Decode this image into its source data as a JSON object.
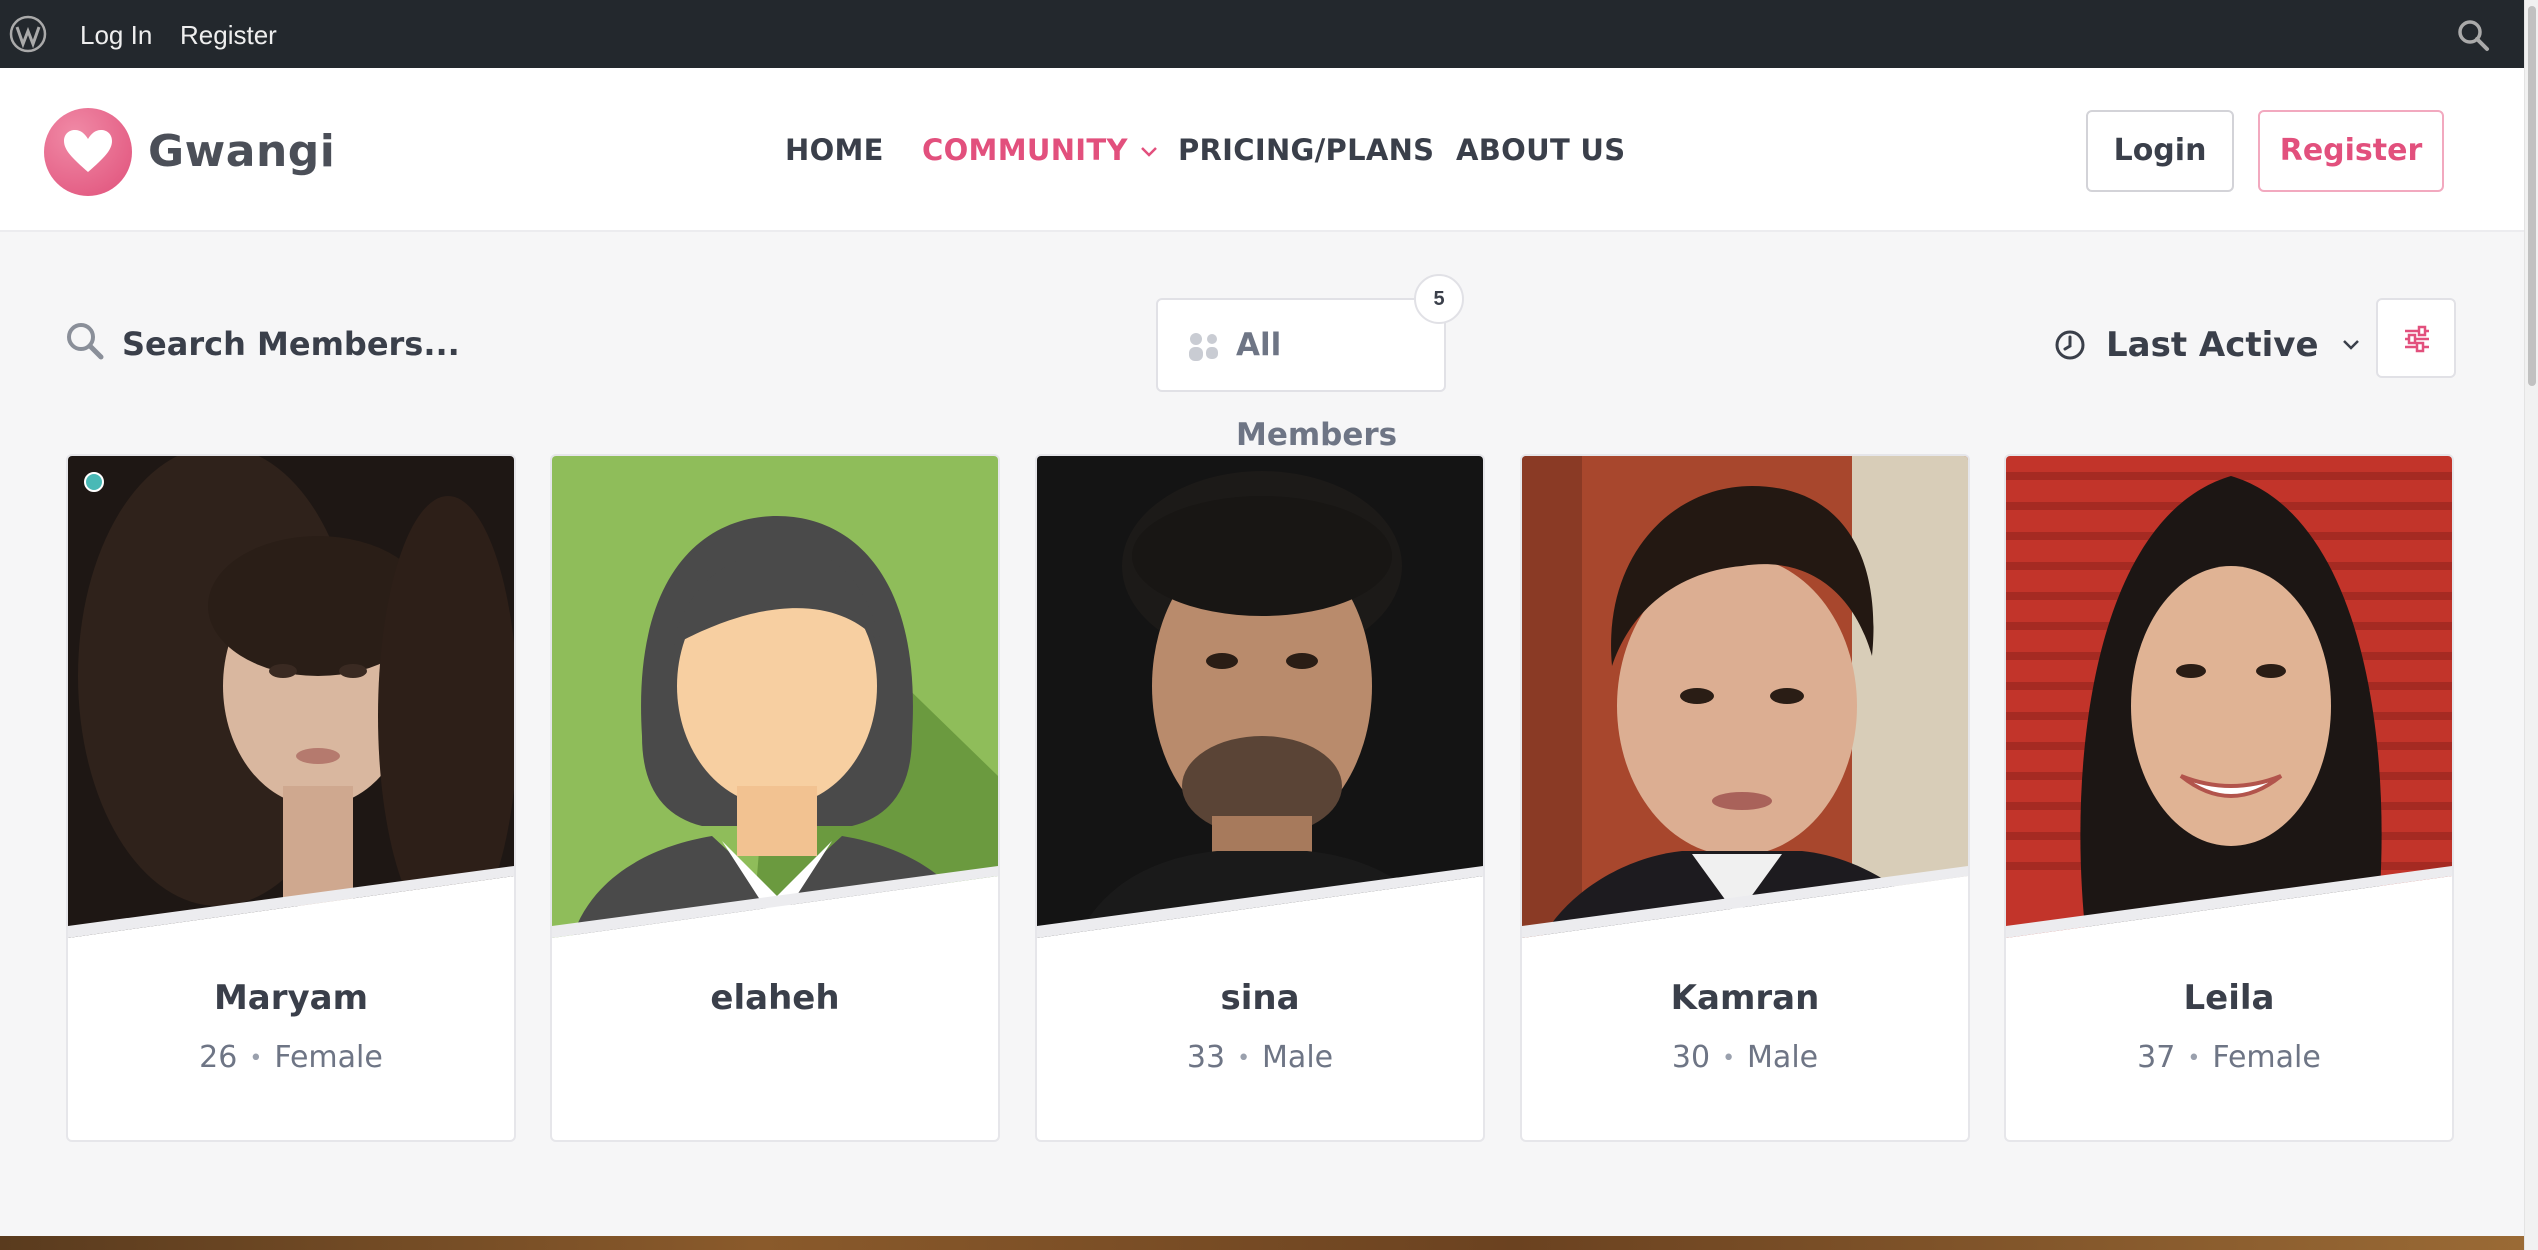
{
  "admin_bar": {
    "login": "Log In",
    "register": "Register"
  },
  "header": {
    "logo_text": "Gwangi",
    "nav": {
      "home": "HOME",
      "community": "COMMUNITY",
      "pricing": "PRICING/PLANS",
      "about": "ABOUT US"
    },
    "login_button": "Login",
    "register_button": "Register"
  },
  "toolbar": {
    "search_placeholder": "Search Members...",
    "filter_label": "All Members",
    "member_count": "5",
    "sort_label": "Last Active"
  },
  "colors": {
    "accent": "#e2507d",
    "online": "#49b9b6",
    "admin_bar": "#23282d"
  },
  "members": [
    {
      "name": "Maryam",
      "age": "26",
      "gender": "Female",
      "online": true
    },
    {
      "name": "elaheh",
      "age": "",
      "gender": "",
      "online": false
    },
    {
      "name": "sina",
      "age": "33",
      "gender": "Male",
      "online": false
    },
    {
      "name": "Kamran",
      "age": "30",
      "gender": "Male",
      "online": false
    },
    {
      "name": "Leila",
      "age": "37",
      "gender": "Female",
      "online": false
    }
  ]
}
